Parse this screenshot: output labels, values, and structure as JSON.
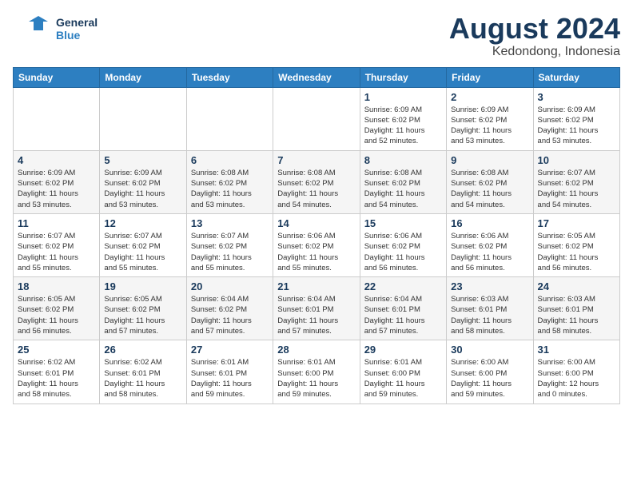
{
  "logo": {
    "line1": "General",
    "line2": "Blue"
  },
  "title": "August 2024",
  "subtitle": "Kedondong, Indonesia",
  "days_of_week": [
    "Sunday",
    "Monday",
    "Tuesday",
    "Wednesday",
    "Thursday",
    "Friday",
    "Saturday"
  ],
  "weeks": [
    [
      {
        "day": "",
        "info": ""
      },
      {
        "day": "",
        "info": ""
      },
      {
        "day": "",
        "info": ""
      },
      {
        "day": "",
        "info": ""
      },
      {
        "day": "1",
        "info": "Sunrise: 6:09 AM\nSunset: 6:02 PM\nDaylight: 11 hours\nand 52 minutes."
      },
      {
        "day": "2",
        "info": "Sunrise: 6:09 AM\nSunset: 6:02 PM\nDaylight: 11 hours\nand 53 minutes."
      },
      {
        "day": "3",
        "info": "Sunrise: 6:09 AM\nSunset: 6:02 PM\nDaylight: 11 hours\nand 53 minutes."
      }
    ],
    [
      {
        "day": "4",
        "info": "Sunrise: 6:09 AM\nSunset: 6:02 PM\nDaylight: 11 hours\nand 53 minutes."
      },
      {
        "day": "5",
        "info": "Sunrise: 6:09 AM\nSunset: 6:02 PM\nDaylight: 11 hours\nand 53 minutes."
      },
      {
        "day": "6",
        "info": "Sunrise: 6:08 AM\nSunset: 6:02 PM\nDaylight: 11 hours\nand 53 minutes."
      },
      {
        "day": "7",
        "info": "Sunrise: 6:08 AM\nSunset: 6:02 PM\nDaylight: 11 hours\nand 54 minutes."
      },
      {
        "day": "8",
        "info": "Sunrise: 6:08 AM\nSunset: 6:02 PM\nDaylight: 11 hours\nand 54 minutes."
      },
      {
        "day": "9",
        "info": "Sunrise: 6:08 AM\nSunset: 6:02 PM\nDaylight: 11 hours\nand 54 minutes."
      },
      {
        "day": "10",
        "info": "Sunrise: 6:07 AM\nSunset: 6:02 PM\nDaylight: 11 hours\nand 54 minutes."
      }
    ],
    [
      {
        "day": "11",
        "info": "Sunrise: 6:07 AM\nSunset: 6:02 PM\nDaylight: 11 hours\nand 55 minutes."
      },
      {
        "day": "12",
        "info": "Sunrise: 6:07 AM\nSunset: 6:02 PM\nDaylight: 11 hours\nand 55 minutes."
      },
      {
        "day": "13",
        "info": "Sunrise: 6:07 AM\nSunset: 6:02 PM\nDaylight: 11 hours\nand 55 minutes."
      },
      {
        "day": "14",
        "info": "Sunrise: 6:06 AM\nSunset: 6:02 PM\nDaylight: 11 hours\nand 55 minutes."
      },
      {
        "day": "15",
        "info": "Sunrise: 6:06 AM\nSunset: 6:02 PM\nDaylight: 11 hours\nand 56 minutes."
      },
      {
        "day": "16",
        "info": "Sunrise: 6:06 AM\nSunset: 6:02 PM\nDaylight: 11 hours\nand 56 minutes."
      },
      {
        "day": "17",
        "info": "Sunrise: 6:05 AM\nSunset: 6:02 PM\nDaylight: 11 hours\nand 56 minutes."
      }
    ],
    [
      {
        "day": "18",
        "info": "Sunrise: 6:05 AM\nSunset: 6:02 PM\nDaylight: 11 hours\nand 56 minutes."
      },
      {
        "day": "19",
        "info": "Sunrise: 6:05 AM\nSunset: 6:02 PM\nDaylight: 11 hours\nand 57 minutes."
      },
      {
        "day": "20",
        "info": "Sunrise: 6:04 AM\nSunset: 6:02 PM\nDaylight: 11 hours\nand 57 minutes."
      },
      {
        "day": "21",
        "info": "Sunrise: 6:04 AM\nSunset: 6:01 PM\nDaylight: 11 hours\nand 57 minutes."
      },
      {
        "day": "22",
        "info": "Sunrise: 6:04 AM\nSunset: 6:01 PM\nDaylight: 11 hours\nand 57 minutes."
      },
      {
        "day": "23",
        "info": "Sunrise: 6:03 AM\nSunset: 6:01 PM\nDaylight: 11 hours\nand 58 minutes."
      },
      {
        "day": "24",
        "info": "Sunrise: 6:03 AM\nSunset: 6:01 PM\nDaylight: 11 hours\nand 58 minutes."
      }
    ],
    [
      {
        "day": "25",
        "info": "Sunrise: 6:02 AM\nSunset: 6:01 PM\nDaylight: 11 hours\nand 58 minutes."
      },
      {
        "day": "26",
        "info": "Sunrise: 6:02 AM\nSunset: 6:01 PM\nDaylight: 11 hours\nand 58 minutes."
      },
      {
        "day": "27",
        "info": "Sunrise: 6:01 AM\nSunset: 6:01 PM\nDaylight: 11 hours\nand 59 minutes."
      },
      {
        "day": "28",
        "info": "Sunrise: 6:01 AM\nSunset: 6:00 PM\nDaylight: 11 hours\nand 59 minutes."
      },
      {
        "day": "29",
        "info": "Sunrise: 6:01 AM\nSunset: 6:00 PM\nDaylight: 11 hours\nand 59 minutes."
      },
      {
        "day": "30",
        "info": "Sunrise: 6:00 AM\nSunset: 6:00 PM\nDaylight: 11 hours\nand 59 minutes."
      },
      {
        "day": "31",
        "info": "Sunrise: 6:00 AM\nSunset: 6:00 PM\nDaylight: 12 hours\nand 0 minutes."
      }
    ]
  ]
}
